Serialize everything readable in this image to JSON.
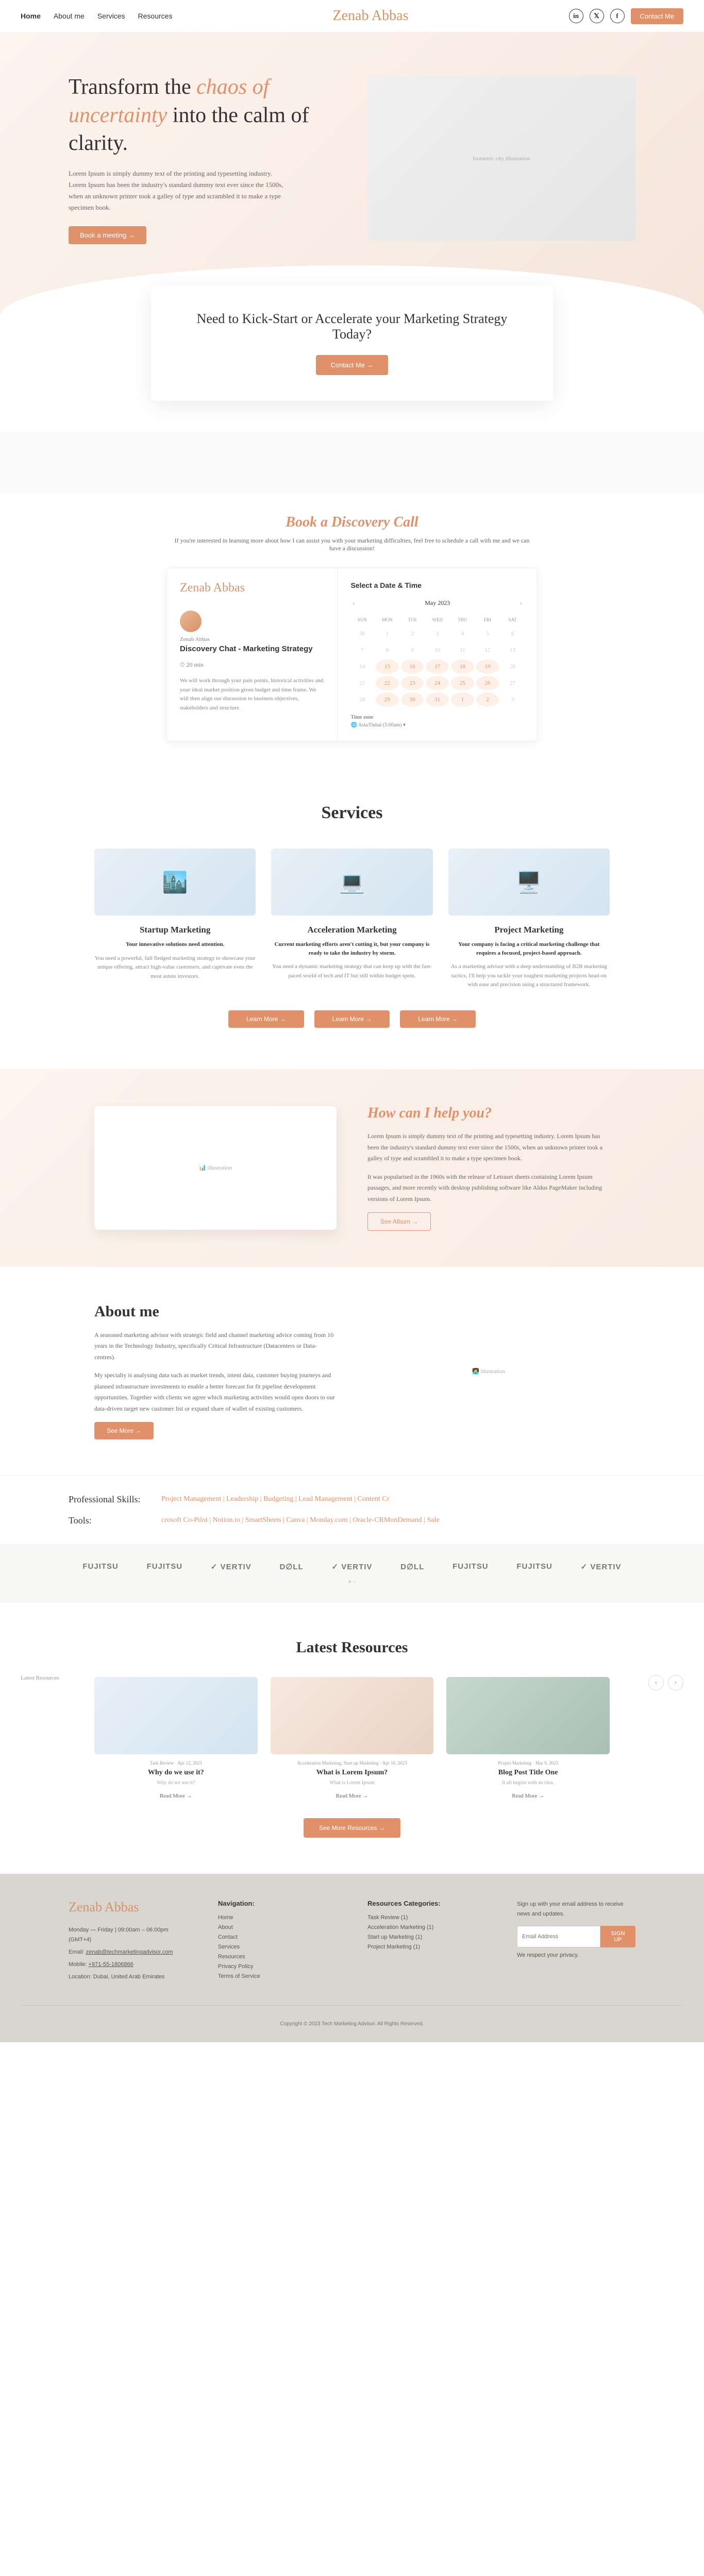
{
  "nav": {
    "items": [
      "Home",
      "About me",
      "Services",
      "Resources"
    ],
    "contact": "Contact Me"
  },
  "logo": "Zenab Abbas",
  "hero": {
    "h1_a": "Transform the ",
    "h1_accent1": "chaos of uncertainty",
    "h1_b": " into the calm of clarity.",
    "body": "Lorem Ipsum is simply dummy text of the printing and typesetting industry. Lorem Ipsum has been the industry's standard dummy text ever since the 1500s, when an unknown printer took a galley of type and scrambled it to make a type specimen book.",
    "cta": "Book a meeting →",
    "img_alt": "Isometric city illustration"
  },
  "kickstart": {
    "heading": "Need to Kick-Start or Accelerate your Marketing Strategy Today?",
    "cta": "Contact Me →"
  },
  "discovery": {
    "heading": "Book a Discovery Call",
    "sub": "If you're interested in learning more about how I can assist you with your marketing difficulties, feel free to schedule a call with me and we can have a discussion!"
  },
  "calendly": {
    "name": "Zenab Abbas",
    "title": "Discovery Chat - Marketing Strategy",
    "duration": "⏱ 20 min",
    "desc": "We will work through your pain points, historical activities and your ideal market position given budget and time frame. We will then align our discussion to business objectives, stakeholders and structure.",
    "select": "Select a Date & Time",
    "month": "May 2023",
    "dow": [
      "SUN",
      "MON",
      "TUE",
      "WED",
      "THU",
      "FRI",
      "SAT"
    ],
    "days": [
      {
        "n": "30",
        "a": 0
      },
      {
        "n": "1",
        "a": 0
      },
      {
        "n": "2",
        "a": 0
      },
      {
        "n": "3",
        "a": 0
      },
      {
        "n": "4",
        "a": 0
      },
      {
        "n": "5",
        "a": 0
      },
      {
        "n": "6",
        "a": 0
      },
      {
        "n": "7",
        "a": 0
      },
      {
        "n": "8",
        "a": 0
      },
      {
        "n": "9",
        "a": 0
      },
      {
        "n": "10",
        "a": 0
      },
      {
        "n": "11",
        "a": 0
      },
      {
        "n": "12",
        "a": 0
      },
      {
        "n": "13",
        "a": 0
      },
      {
        "n": "14",
        "a": 0
      },
      {
        "n": "15",
        "a": 1
      },
      {
        "n": "16",
        "a": 1
      },
      {
        "n": "17",
        "a": 1
      },
      {
        "n": "18",
        "a": 1
      },
      {
        "n": "19",
        "a": 1
      },
      {
        "n": "20",
        "a": 0
      },
      {
        "n": "21",
        "a": 0
      },
      {
        "n": "22",
        "a": 1
      },
      {
        "n": "23",
        "a": 1
      },
      {
        "n": "24",
        "a": 1
      },
      {
        "n": "25",
        "a": 1
      },
      {
        "n": "26",
        "a": 1
      },
      {
        "n": "27",
        "a": 0
      },
      {
        "n": "28",
        "a": 0
      },
      {
        "n": "29",
        "a": 1
      },
      {
        "n": "30",
        "a": 1
      },
      {
        "n": "31",
        "a": 1
      },
      {
        "n": "1",
        "a": 1
      },
      {
        "n": "2",
        "a": 1
      },
      {
        "n": "3",
        "a": 0
      }
    ],
    "tz_label": "Time zone",
    "tz": "🌐 Asia/Dubai (5:00am) ▾"
  },
  "services": {
    "heading": "Services",
    "cards": [
      {
        "title": "Startup Marketing",
        "bold": "Your innovative solutions need attention.",
        "text": "You need a powerful, full fledged marketing strategy to showcase your unique offering, attract high-value customers, and captivate even the most astute investors."
      },
      {
        "title": "Acceleration Marketing",
        "bold": "Current marketing efforts aren't cutting it, but your company is ready to take the industry by storm.",
        "text": "You need a dynamic marketing strategy that can keep up with the fast-paced world of tech and IT but still within budget spent."
      },
      {
        "title": "Project Marketing",
        "bold": "Your company is facing a critical marketing challenge that requires a focused, project-based approach.",
        "text": "As a marketing advisor with a deep understanding of B2B marketing tactics, I'll help you tackle your toughest marketing projects head-on with ease and precision using a structured framework."
      }
    ],
    "learn": "Learn More →"
  },
  "help": {
    "heading": "How can I help you?",
    "p1": "Lorem Ipsum is simply dummy text of the printing and typesetting industry. Lorem Ipsum has been the industry's standard dummy text ever since the 1500s, when an unknown printer took a galley of type and scrambled it to make a type specimen book.",
    "p2": "It was popularised in the 1960s with the release of Letraset sheets containing Lorem Ipsum passages, and more recently with desktop publishing software like Aldus PageMaker including versions of Lorem Ipsum.",
    "cta": "See Album →"
  },
  "about": {
    "heading": "About me",
    "p1": "A seasoned marketing advisor with strategic field and channel marketing advice coming from 10 years in the Technology Industry, specifically Critical Infrastructure (Datacenters or Data-centres).",
    "p2": "My specialty is analysing data such as market trends, intent data, customer buying journeys and planned infrastructure investments to enable a better forecast for fit pipeline development opportunities. Together with clients we agree which marketing activities would open doors to our data-driven target new customer list or expand share of wallet of existing customers.",
    "cta": "See More →"
  },
  "skills": {
    "label1": "Professional Skills:",
    "items1": "Project Management | Leadership | Budgeting | Lead Management | Content Cr",
    "label2": "Tools:",
    "items2": "crosoft Co-Pilot | Notion.io | SmartSheets | Canva | Monday.com | Oracle-CRMonDemand | Sale"
  },
  "partners": [
    "FUJITSU",
    "FUJITSU",
    "✓ VERTIV",
    "D∅LL",
    "✓ VERTIV",
    "D∅LL",
    "FUJITSU",
    "FUJITSU",
    "✓ VERTIV"
  ],
  "resources": {
    "heading": "Latest Resources",
    "label": "Latest Resources",
    "cards": [
      {
        "cat": "Task Review · Apr 12, 2023",
        "title": "Why do we use it?",
        "sub": "Why do we use it?",
        "read": "Read More →"
      },
      {
        "cat": "Acceleration Marketing, Start up Marketing · Apr 10, 2023",
        "title": "What is Lorem Ipsum?",
        "sub": "What is Lorem Ipsum",
        "read": "Read More →"
      },
      {
        "cat": "Project Marketing · Mar 9, 2023",
        "title": "Blog Post Title One",
        "sub": "It all begins with an idea.",
        "read": "Read More →"
      }
    ],
    "cta": "See More Resources →"
  },
  "footer": {
    "hours": "Monday — Friday | 09:00am – 06:00pm (GMT+4)",
    "email_label": "Email: ",
    "email": "zenab@techmarketingadvisor.com",
    "mobile_label": "Mobile: ",
    "mobile": "+971-55-1806866",
    "loc": "Location: Dubai, United Arab Emirates",
    "nav_h": "Navigation:",
    "nav": [
      "Home",
      "About",
      "Contact",
      "Services",
      "Resources",
      "Privacy Policy",
      "Terms of Service"
    ],
    "cat_h": "Resources Categories:",
    "cat": [
      "Task Review (1)",
      "Acceleration Marketing (1)",
      "Start up Marketing (1)",
      "Project Marketing (1)"
    ],
    "signup_text": "Sign up with your email address to receive news and updates.",
    "placeholder": "Email Address",
    "signup_btn": "SIGN UP",
    "note": "We respect your privacy.",
    "copyright": "Copyright © 2023 Tech Marketing Advisor. All Rights Reserved."
  }
}
